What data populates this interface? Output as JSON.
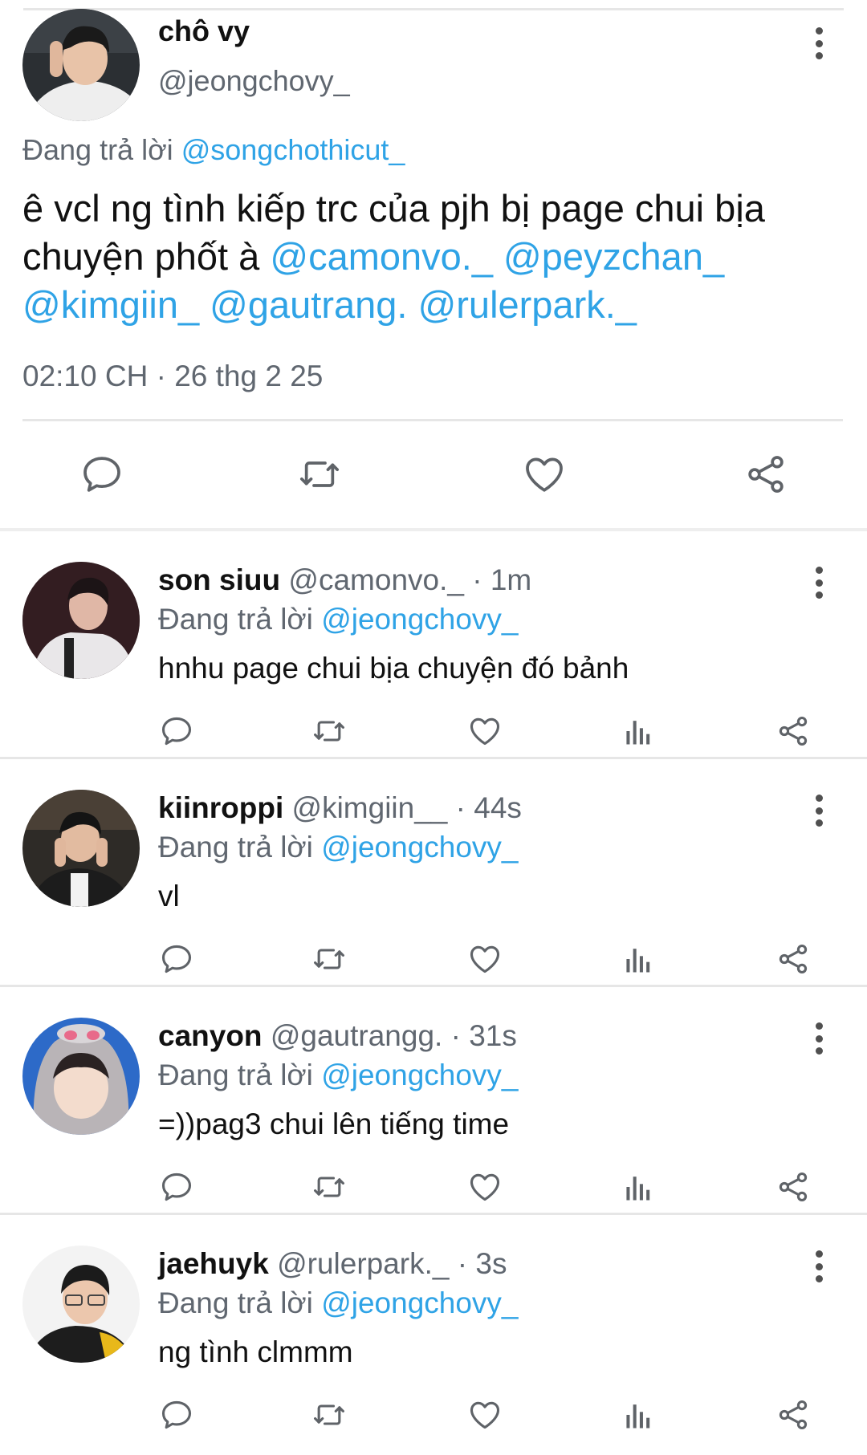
{
  "main_tweet": {
    "name": "chô vy",
    "handle": "@jeongchovy_",
    "replying_label": "Đang trả lời",
    "replying_to": "@songchothicut_",
    "text_prefix": "ê vcl ng tình kiếp trc của pjh bị page chui bịa chuyện phốt à",
    "mentions": [
      "@camonvo._",
      "@peyzchan_",
      "@kimgiin_",
      "@gautrang.",
      "@rulerpark._"
    ],
    "timestamp": "02:10 CH · 26 thg 2 25",
    "actions": [
      "reply-icon",
      "retweet-icon",
      "like-icon",
      "share-icon"
    ]
  },
  "replies": [
    {
      "name": "son siuu",
      "handle": "@camonvo._",
      "time": "1m",
      "replying_label": "Đang trả lời",
      "replying_to": "@jeongchovy_",
      "text": "hnhu page chui bịa chuyện đó bảnh"
    },
    {
      "name": "kiinroppi",
      "handle": "@kimgiin__",
      "time": "44s",
      "replying_label": "Đang trả lời",
      "replying_to": "@jeongchovy_",
      "text": "vl"
    },
    {
      "name": "canyon",
      "handle": "@gautrangg.",
      "time": "31s",
      "replying_label": "Đang trả lời",
      "replying_to": "@jeongchovy_",
      "text": "=))pag3 chui lên tiếng time"
    },
    {
      "name": "jaehuyk",
      "handle": "@rulerpark._",
      "time": "3s",
      "replying_label": "Đang trả lời",
      "replying_to": "@jeongchovy_",
      "text": "ng tình clmmm"
    }
  ],
  "colors": {
    "link": "#2fa3e6",
    "secondary_text": "#606770",
    "icon": "#5f6368"
  }
}
